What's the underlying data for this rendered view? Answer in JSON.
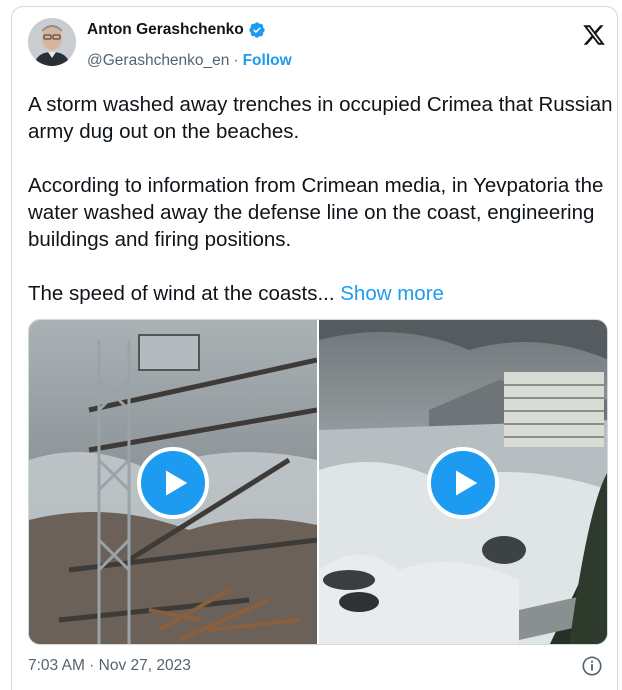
{
  "author": {
    "name": "Anton Gerashchenko",
    "handle": "@Gerashchenko_en",
    "separator": "·",
    "follow_label": "Follow"
  },
  "tweet": {
    "paragraph_1": "A storm washed away trenches in occupied Crimea that Russian army dug out on the beaches.",
    "paragraph_2": "According to information from Crimean media, in Yevpatoria the water washed away the defense line on the coast, engineering buildings and firing positions.",
    "paragraph_3": "The speed of wind at the coasts...",
    "show_more_label": "Show more"
  },
  "media": {
    "videos": [
      {
        "icon": "play-icon"
      },
      {
        "icon": "play-icon"
      }
    ]
  },
  "footer": {
    "timestamp": "7:03 AM · Nov 27, 2023",
    "info_icon": "info-icon"
  },
  "colors": {
    "accent": "#1d9bf0",
    "text": "#0f1419",
    "muted": "#536471",
    "border": "#cfd9de"
  }
}
